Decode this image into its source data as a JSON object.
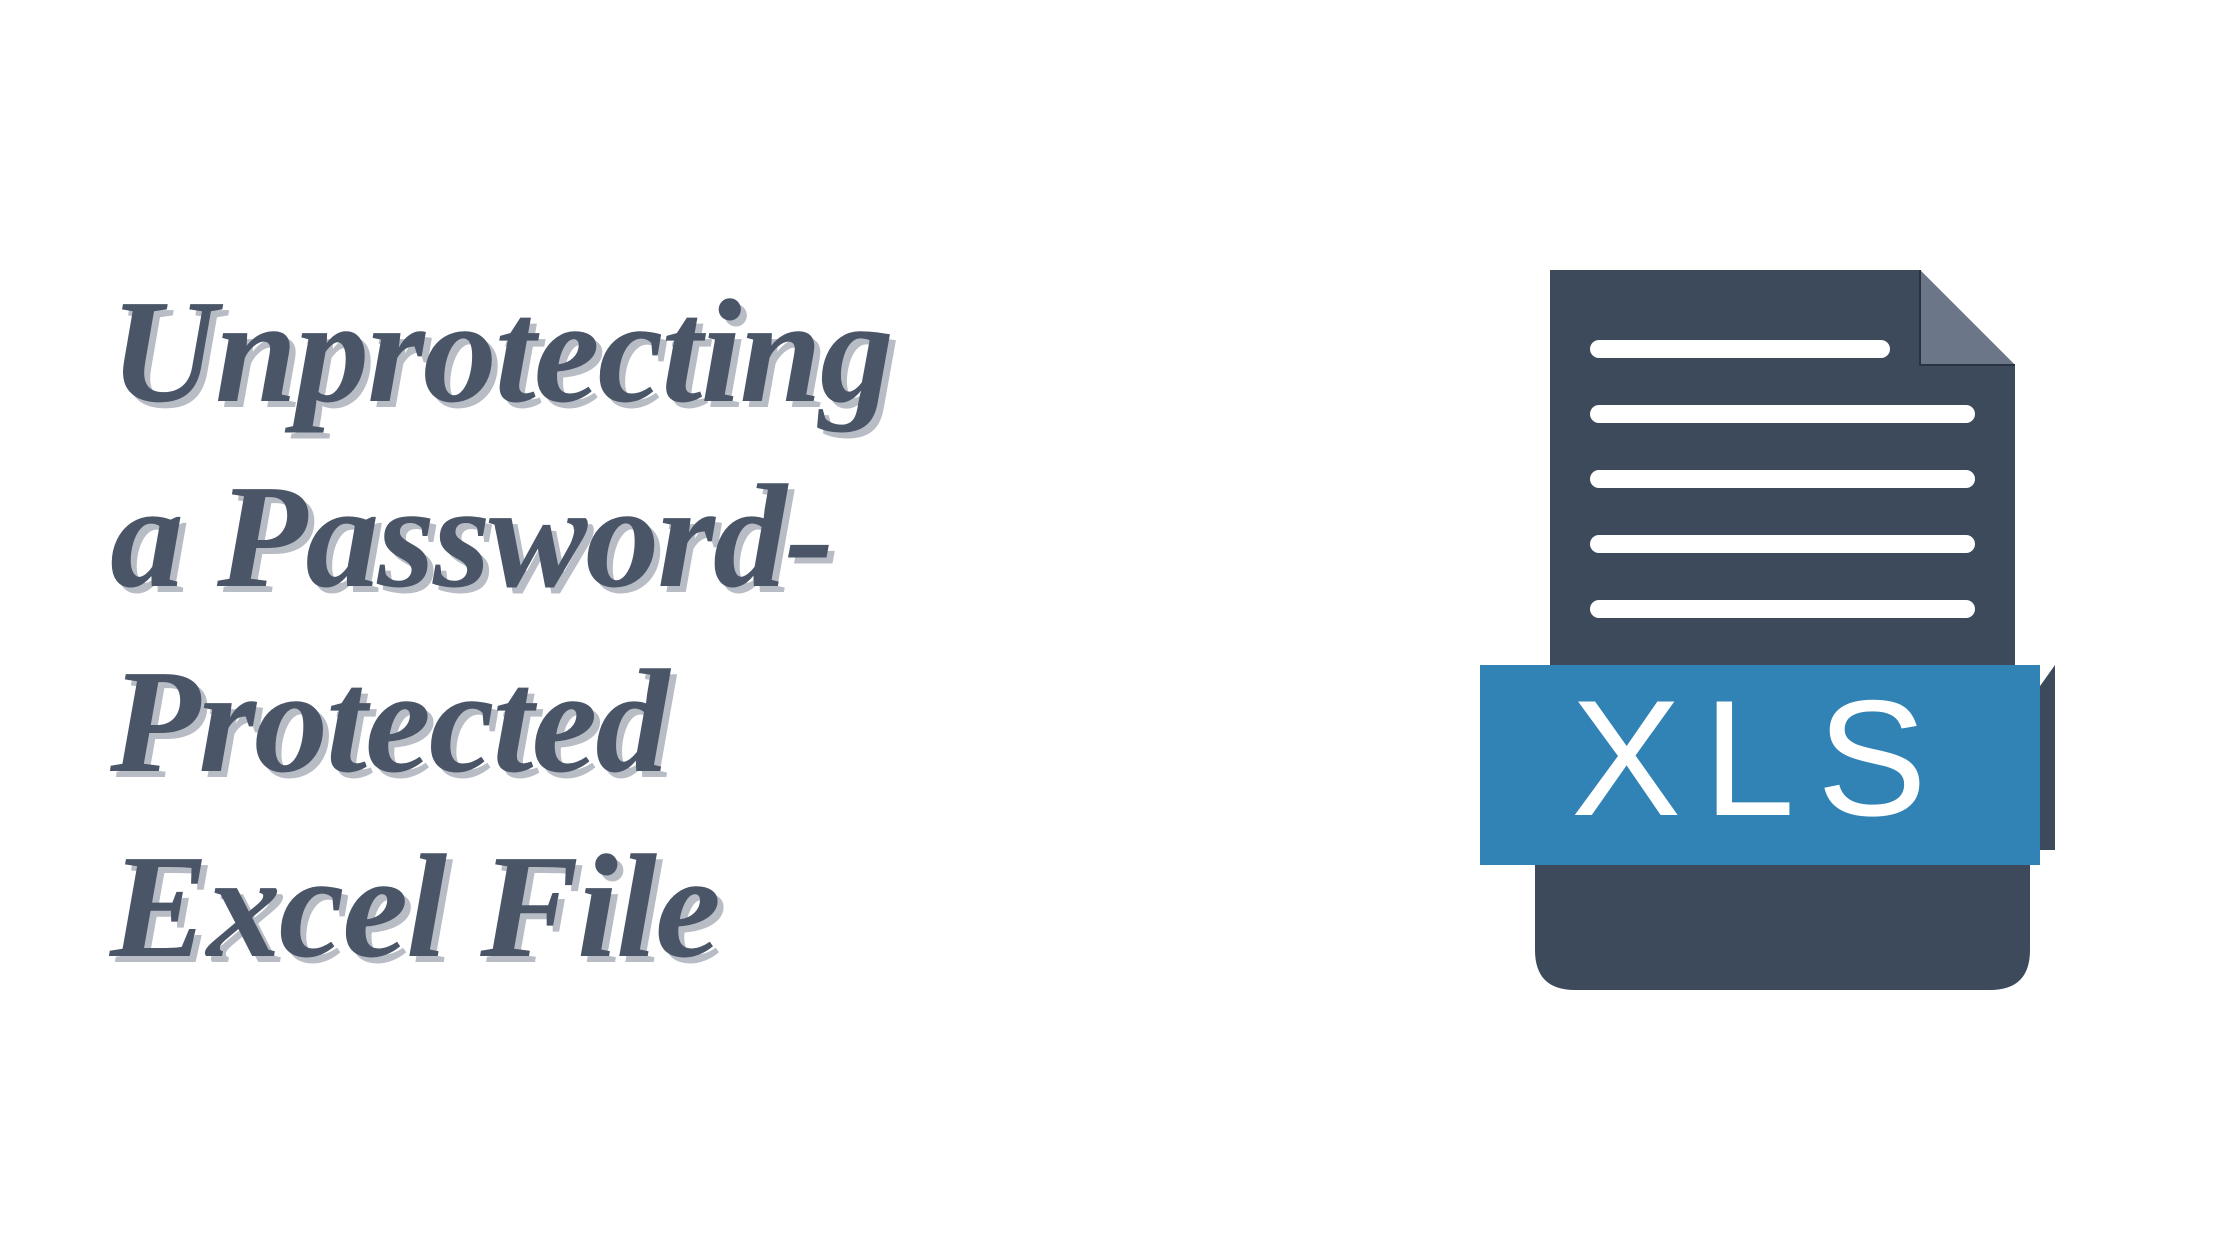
{
  "title": {
    "line1": "Unprotecting",
    "line2": "a Password-",
    "line3": "Protected",
    "line4": "Excel File"
  },
  "icon": {
    "label": "XLS",
    "colors": {
      "document": "#3d4a5c",
      "banner": "#3182b5",
      "text": "#ffffff"
    }
  }
}
